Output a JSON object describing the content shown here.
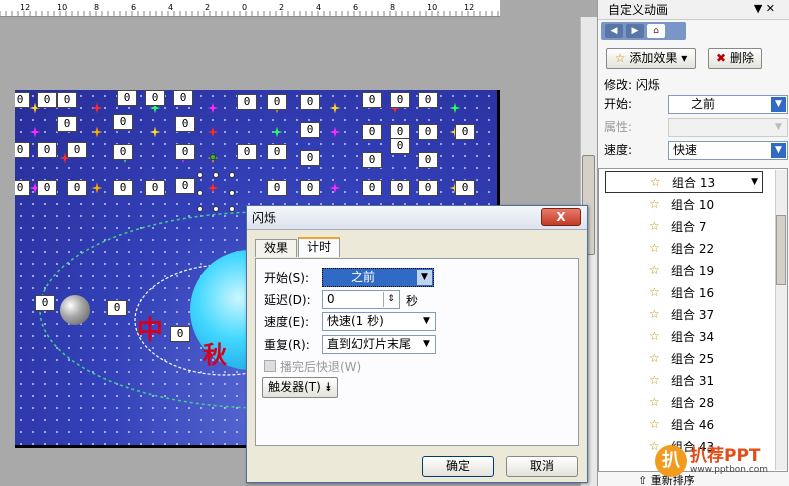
{
  "ruler": {
    "labels": [
      "12",
      "10",
      "8",
      "6",
      "4",
      "2",
      "0",
      "2",
      "4",
      "6",
      "8",
      "10",
      "12"
    ]
  },
  "slide": {
    "zero_label": "0",
    "calligraphy_zhong": "中",
    "calligraphy_qiu": "秋"
  },
  "dialog": {
    "title": "闪烁",
    "close_label": "X",
    "tabs": [
      "效果",
      "计时"
    ],
    "start_label": "开始(S):",
    "start_value": "之前",
    "delay_label": "延迟(D):",
    "delay_value": "0",
    "delay_unit": "秒",
    "speed_label": "速度(E):",
    "speed_value": "快速(1 秒)",
    "repeat_label": "重复(R):",
    "repeat_value": "直到幻灯片末尾",
    "rewind_label": "播完后快退(W)",
    "trigger_label": "触发器(T)",
    "ok_label": "确定",
    "cancel_label": "取消"
  },
  "pane": {
    "title": "自定义动画",
    "add_effect_label": "添加效果",
    "delete_label": "删除",
    "modify_label": "修改: 闪烁",
    "start_label": "开始:",
    "start_value": "之前",
    "property_label": "属性:",
    "speed_label": "速度:",
    "speed_value": "快速",
    "items": [
      {
        "name": "组合 13"
      },
      {
        "name": "组合 10"
      },
      {
        "name": "组合 7"
      },
      {
        "name": "组合 22"
      },
      {
        "name": "组合 19"
      },
      {
        "name": "组合 16"
      },
      {
        "name": "组合 37"
      },
      {
        "name": "组合 34"
      },
      {
        "name": "组合 25"
      },
      {
        "name": "组合 31"
      },
      {
        "name": "组合 28"
      },
      {
        "name": "组合 46"
      },
      {
        "name": "组合 43"
      }
    ],
    "reorder_label": "重新排序"
  },
  "watermark": {
    "logo": "扒",
    "brand": "扒荐PPT",
    "url": "www.pptbon.com"
  },
  "colors": {
    "slide_bg": "#3340b8",
    "accent_orange": "#f29c1f",
    "dialog_bg": "#ece9d8"
  }
}
